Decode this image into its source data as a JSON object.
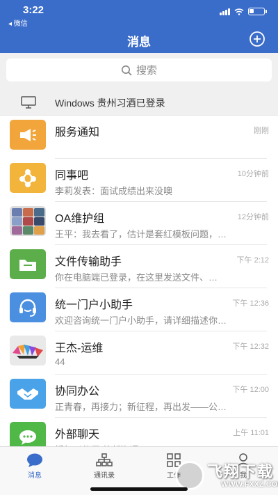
{
  "status_bar": {
    "time": "3:22",
    "back_app": "◂ 微信"
  },
  "header": {
    "title": "消息"
  },
  "search": {
    "placeholder": "搜索"
  },
  "login_notice": {
    "text": "Windows 贵州习酒已登录"
  },
  "chats": [
    {
      "name": "服务通知",
      "time": "刚刚",
      "preview": "",
      "icon": "megaphone-icon",
      "color": "#f2a53a"
    },
    {
      "name": "同事吧",
      "time": "10分钟前",
      "preview": "李莉发表：面试成绩出来没噢",
      "icon": "network-icon",
      "color": "#f2b43a"
    },
    {
      "name": "OA维护组",
      "time": "12分钟前",
      "preview": "王平：我去看了，估计是套红模板问题，…",
      "icon": "group-avatar-icon",
      "color": "#6a7fb0"
    },
    {
      "name": "文件传输助手",
      "time": "下午 2:12",
      "preview": "你在电脑端已登录，在这里发送文件、…",
      "icon": "folder-icon",
      "color": "#5cae4a"
    },
    {
      "name": "统一门户小助手",
      "time": "下午 12:36",
      "preview": "欢迎咨询统一门户小助手，请详细描述你…",
      "icon": "headset-icon",
      "color": "#4a8fe0"
    },
    {
      "name": "王杰-运维",
      "time": "下午 12:32",
      "preview": "44",
      "icon": "colorful-avatar-icon",
      "color": "#e9e9e9"
    },
    {
      "name": "协同办公",
      "time": "下午 12:00",
      "preview": "正青春，再接力；新征程，再出发——公…",
      "icon": "handshake-icon",
      "color": "#4aa3e8"
    },
    {
      "name": "外部聊天",
      "time": "上午 11:01",
      "preview": "授权以使用 外部沟通",
      "icon": "chat-bubble-icon",
      "color": "#4fb847"
    }
  ],
  "tabs": [
    {
      "label": "消息",
      "icon": "chat-icon",
      "active": true
    },
    {
      "label": "通讯录",
      "icon": "org-chart-icon",
      "active": false
    },
    {
      "label": "工作",
      "icon": "grid-icon",
      "active": false
    },
    {
      "label": "我",
      "icon": "person-icon",
      "active": false
    }
  ],
  "watermark": {
    "brand": "飞翔下载",
    "url": "WWW.FXXZ.COM"
  },
  "colors": {
    "accent": "#3a6cc9",
    "background": "#f0f0f0"
  }
}
